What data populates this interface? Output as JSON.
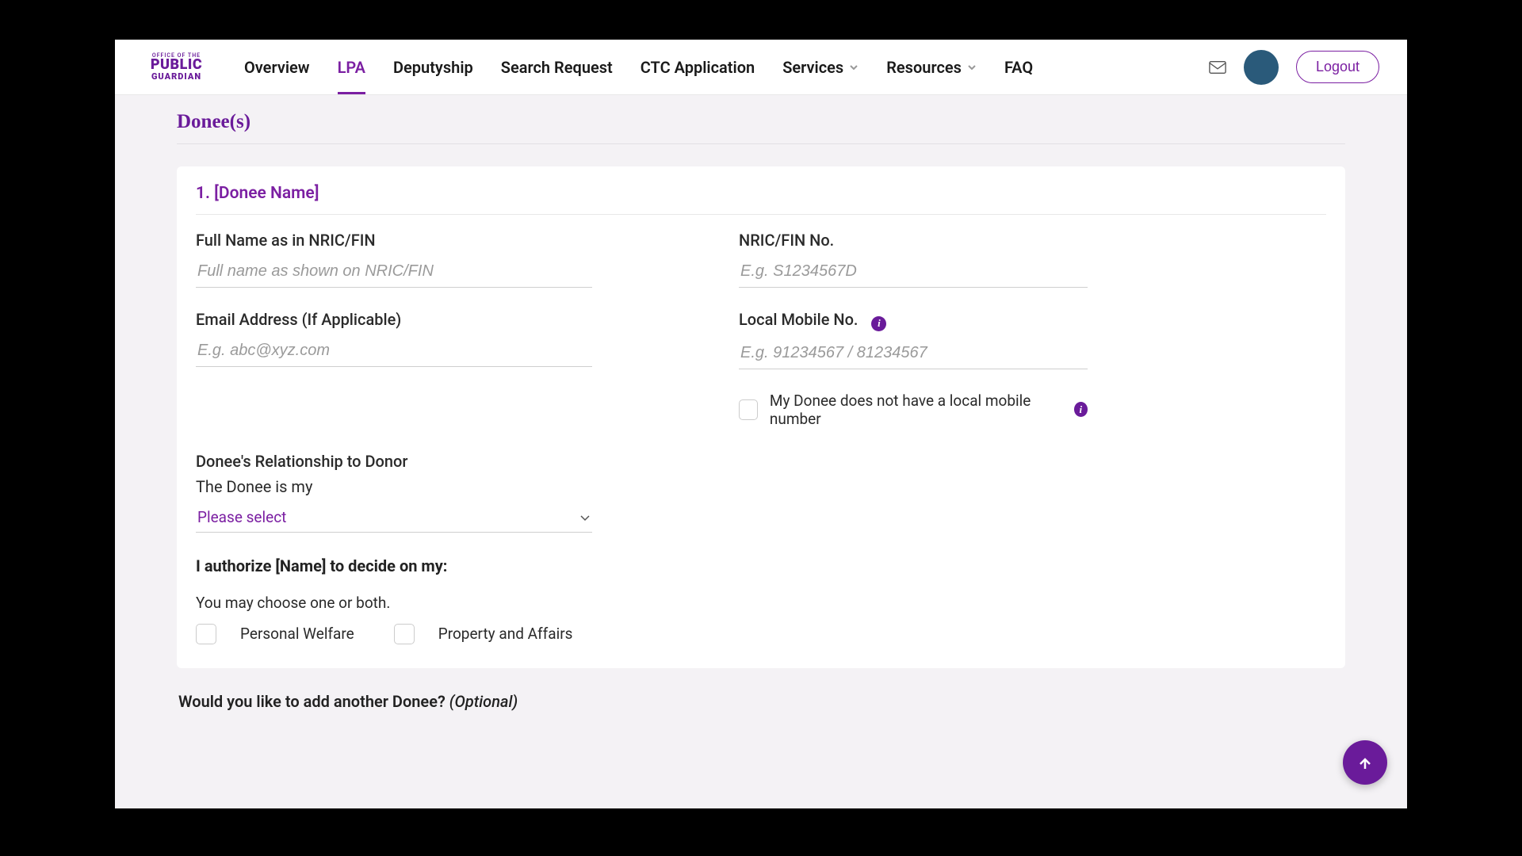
{
  "logo": {
    "line1": "OFFICE OF THE",
    "line2": "PUBLIC",
    "line3": "GUARDIAN"
  },
  "nav": {
    "overview": "Overview",
    "lpa": "LPA",
    "deputyship": "Deputyship",
    "search": "Search Request",
    "ctc": "CTC Application",
    "services": "Services",
    "resources": "Resources",
    "faq": "FAQ"
  },
  "header": {
    "logout": "Logout"
  },
  "section": {
    "title": "Donee(s)"
  },
  "donee": {
    "heading": "1. [Donee Name]",
    "fullname_label": "Full Name as in NRIC/FIN",
    "fullname_ph": "Full name as shown on NRIC/FIN",
    "nric_label": "NRIC/FIN No.",
    "nric_ph": "E.g. S1234567D",
    "email_label": "Email Address (If Applicable)",
    "email_ph": "E.g. abc@xyz.com",
    "mobile_label": "Local Mobile No.",
    "mobile_ph": "E.g. 91234567 / 81234567",
    "no_mobile": "My Donee does not have a local mobile number",
    "rel_label": "Donee's Relationship to Donor",
    "rel_sub": "The Donee is my",
    "rel_select": "Please select",
    "auth_title": "I authorize [Name] to decide on my:",
    "auth_hint": "You may choose one or both.",
    "opt_pw": "Personal Welfare",
    "opt_pa": "Property and Affairs"
  },
  "footer": {
    "q": "Would you like to add another Donee? ",
    "opt": "(Optional)"
  }
}
